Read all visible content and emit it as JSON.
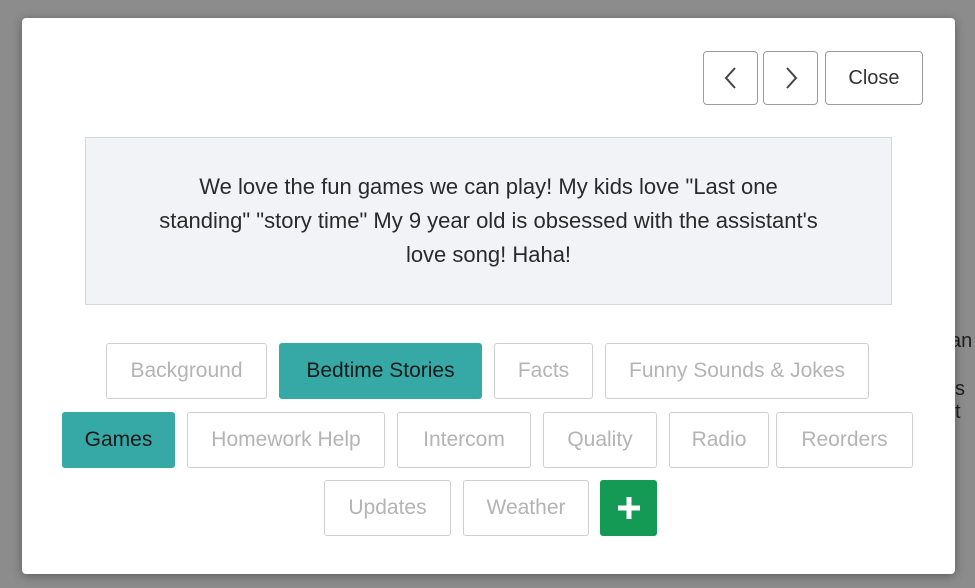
{
  "backdrop": {
    "fragment_1": "an",
    "fragment_2": "s t"
  },
  "modal": {
    "close_label": "Close",
    "prev_icon": "chevron-left-icon",
    "next_icon": "chevron-right-icon",
    "comment": "We love the fun games we can play! My kids love \"Last one standing\" \"story time\" My 9 year old is obsessed with the assistant's love song! Haha!",
    "add_icon": "plus-icon"
  },
  "tags": [
    {
      "label": "Background",
      "active": false
    },
    {
      "label": "Bedtime Stories",
      "active": true
    },
    {
      "label": "Facts",
      "active": false
    },
    {
      "label": "Funny Sounds & Jokes",
      "active": false
    },
    {
      "label": "Games",
      "active": true
    },
    {
      "label": "Homework Help",
      "active": false
    },
    {
      "label": "Intercom",
      "active": false
    },
    {
      "label": "Quality",
      "active": false
    },
    {
      "label": "Radio",
      "active": false
    },
    {
      "label": "Reorders",
      "active": false
    },
    {
      "label": "Updates",
      "active": false
    },
    {
      "label": "Weather",
      "active": false
    }
  ],
  "colors": {
    "active_tag": "#36a8a6",
    "add_button": "#159a55",
    "comment_bg": "#f1f3f6"
  }
}
